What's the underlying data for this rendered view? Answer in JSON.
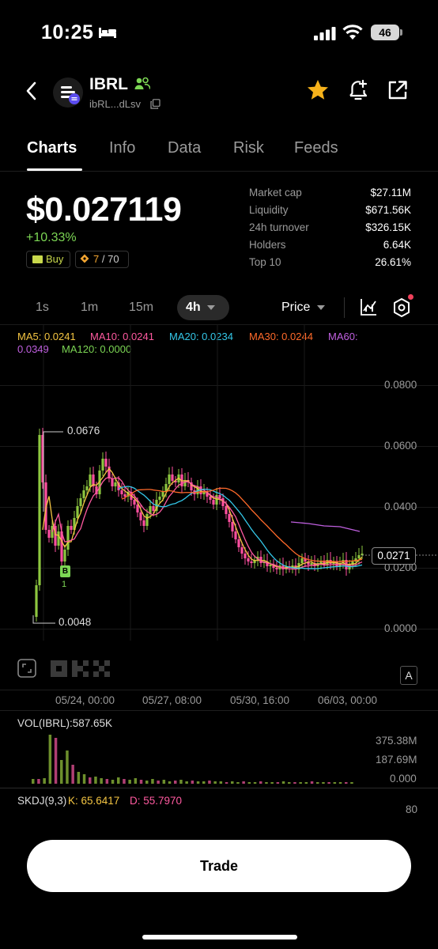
{
  "status_bar": {
    "time": "10:25",
    "battery": "46"
  },
  "token": {
    "symbol": "IBRL",
    "address": "ibRL...dLsv"
  },
  "tabs": [
    {
      "label": "Charts"
    },
    {
      "label": "Info"
    },
    {
      "label": "Data"
    },
    {
      "label": "Risk"
    },
    {
      "label": "Feeds"
    }
  ],
  "price": {
    "value": "$0.027119",
    "change": "+10.33%",
    "buy_label": "Buy",
    "rank": "7",
    "rank_total": "/ 70"
  },
  "stats": [
    {
      "label": "Market cap",
      "value": "$27.11M"
    },
    {
      "label": "Liquidity",
      "value": "$671.56K"
    },
    {
      "label": "24h turnover",
      "value": "$326.15K"
    },
    {
      "label": "Holders",
      "value": "6.64K"
    },
    {
      "label": "Top 10",
      "value": "26.61%"
    }
  ],
  "timeframes": [
    "1s",
    "1m",
    "15m",
    "4h"
  ],
  "price_selector": "Price",
  "ma_labels": {
    "ma5": "MA5: 0.0241",
    "ma10": "MA10: 0.0241",
    "ma20": "MA20: 0.0234",
    "ma30": "MA30: 0.0244",
    "ma60": "MA60:",
    "ma60_val": "0.0349",
    "ma120": "MA120: 0.0000"
  },
  "colors": {
    "up": "#8dc63f",
    "down": "#ff4fa0",
    "ma5": "#f4c542",
    "ma10": "#ff5aa0",
    "ma20": "#34c7e8",
    "ma30": "#ff6a2a",
    "ma60": "#c060e0",
    "ma120": "#7cd654"
  },
  "chart_data": {
    "type": "candlestick",
    "y_ticks": [
      "0.0000",
      "0.0200",
      "0.0400",
      "0.0600",
      "0.0800"
    ],
    "high_label": "0.0676",
    "low_label": "0.0048",
    "current_price": "0.0271",
    "buy_marker": "B",
    "buy_marker_count": "1",
    "dates": [
      "05/24, 00:00",
      "05/27, 08:00",
      "05/30, 16:00",
      "06/03, 00:00"
    ],
    "volume_label": "VOL(IBRL):587.65K",
    "volume_ticks": [
      "375.38M",
      "187.69M",
      "0.000"
    ],
    "skdj_label": "SKDJ(9,3)",
    "skdj_k": "K: 65.6417",
    "skdj_d": "D: 55.7970",
    "skdj_tick": "80"
  },
  "auto_label": "A",
  "trade_label": "Trade"
}
